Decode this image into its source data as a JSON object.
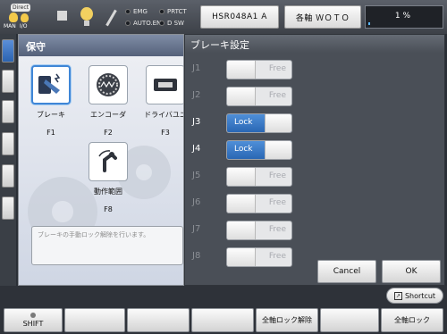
{
  "topbar": {
    "mode_bubble": "Direct",
    "mode_man": "MAN",
    "mode_io": "I/O",
    "leds": [
      "EMG",
      "PRTCT",
      "AUTO.EN",
      "D SW"
    ],
    "robot_button": "HSR048A1 A",
    "axis_button": "各軸 ＷＯＴＯ",
    "speed_value": "1 %",
    "speed_fraction": 0.03,
    "accent": "#58b6ff"
  },
  "maintenance": {
    "title": "保守",
    "tiles": [
      {
        "name": "brake",
        "label": "ブレーキ",
        "fkey": "F1",
        "icon": "brake-icon"
      },
      {
        "name": "encoder",
        "label": "エンコーダ",
        "fkey": "F2",
        "icon": "encoder-icon"
      },
      {
        "name": "driver-unit",
        "label": "ドライバユニ",
        "fkey": "F3",
        "icon": "driver-unit-icon"
      },
      {
        "name": "motion-range",
        "label": "動作範囲",
        "fkey": "F8",
        "icon": "motion-range-icon"
      }
    ],
    "description": "ブレーキの手動ロック解除を行います。"
  },
  "brake_dialog": {
    "title": "ブレーキ設定",
    "joints": [
      {
        "label": "J1",
        "state": "Free",
        "enabled": false
      },
      {
        "label": "J2",
        "state": "Free",
        "enabled": false
      },
      {
        "label": "J3",
        "state": "Lock",
        "enabled": true
      },
      {
        "label": "J4",
        "state": "Lock",
        "enabled": true
      },
      {
        "label": "J5",
        "state": "Free",
        "enabled": false
      },
      {
        "label": "J6",
        "state": "Free",
        "enabled": false
      },
      {
        "label": "J7",
        "state": "Free",
        "enabled": false
      },
      {
        "label": "J8",
        "state": "Free",
        "enabled": false
      }
    ],
    "cancel_label": "Cancel",
    "ok_label": "OK",
    "lock_color": "#2f6fc0"
  },
  "bottom": {
    "shortcut_label": "Shortcut",
    "fkeys": [
      "SHIFT",
      "",
      "",
      "",
      "全軸ロック解除",
      "",
      "全軸ロック"
    ]
  }
}
